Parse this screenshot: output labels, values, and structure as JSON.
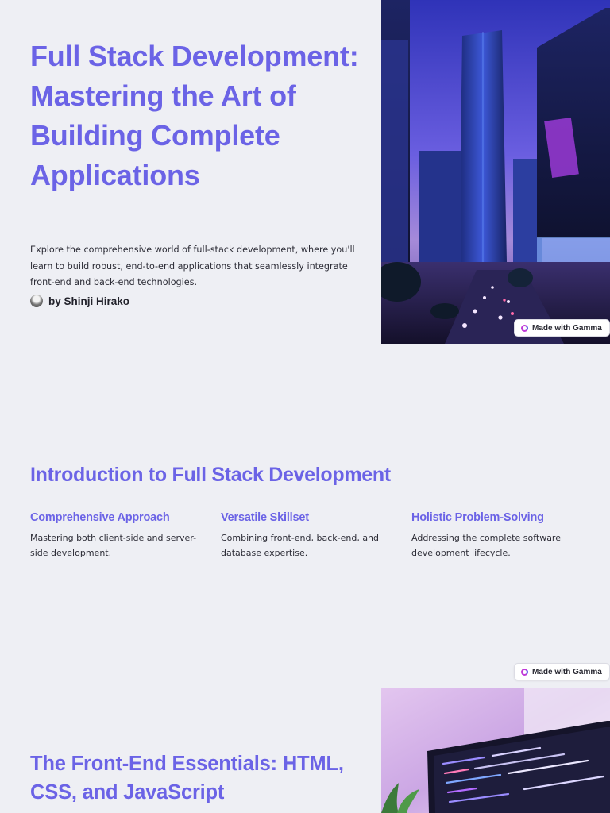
{
  "hero": {
    "title": "Full Stack Development: Mastering the Art of Building Complete Applications",
    "description": "Explore the comprehensive world of full-stack development, where you'll learn to build robust, end-to-end applications that seamlessly integrate front-end and back-end technologies.",
    "author": "by Shinji Hirako"
  },
  "badge": {
    "label": "Made with Gamma"
  },
  "intro": {
    "title": "Introduction to Full Stack Development",
    "features": [
      {
        "title": "Comprehensive Approach",
        "description": "Mastering both client-side and server-side development."
      },
      {
        "title": "Versatile Skillset",
        "description": "Combining front-end, back-end, and database expertise."
      },
      {
        "title": "Holistic Problem-Solving",
        "description": "Addressing the complete software development lifecycle."
      }
    ]
  },
  "frontend": {
    "title": "The Front-End Essentials: HTML, CSS, and JavaScript"
  },
  "colors": {
    "accent": "#6b63e6",
    "background": "#eeeff4",
    "gamma_icon": "#c03ad8"
  },
  "icons": [
    "gamma-logo-icon"
  ]
}
